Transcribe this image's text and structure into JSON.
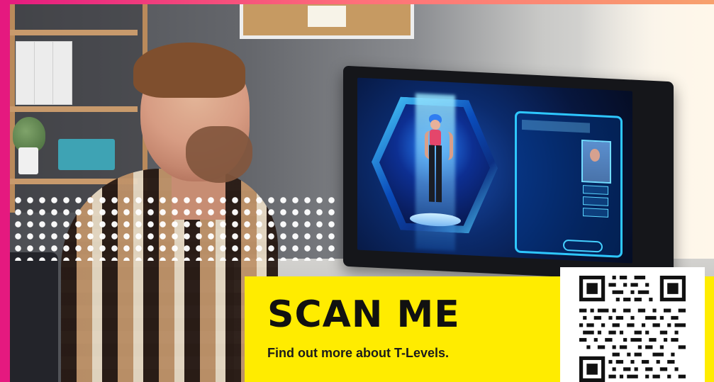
{
  "banner": {
    "title": "SCAN ME",
    "subtitle": "Find out more about T-Levels."
  },
  "colors": {
    "accent_pink": "#e5197f",
    "banner_yellow": "#ffec00",
    "qr_black": "#111111"
  },
  "icons": {
    "dot_pattern": "dot-pattern-icon",
    "qr_code": "qr-code-icon"
  }
}
